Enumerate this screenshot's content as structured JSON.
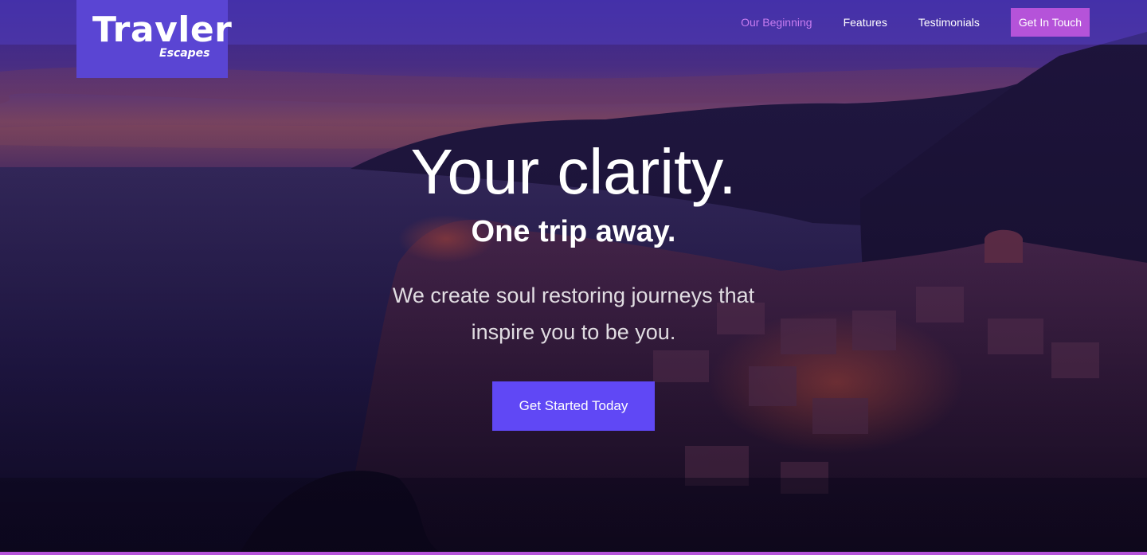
{
  "brand": {
    "name": "Travler",
    "tagline": "Escapes"
  },
  "nav": {
    "items": [
      {
        "label": "Our Beginning",
        "active": true
      },
      {
        "label": "Features",
        "active": false
      },
      {
        "label": "Testimonials",
        "active": false
      }
    ],
    "cta_label": "Get In Touch"
  },
  "hero": {
    "headline": "Your clarity.",
    "subheadline": "One trip away.",
    "description_line1": "We create soul restoring journeys that",
    "description_line2": "inspire you to be you.",
    "cta_label": "Get Started Today"
  },
  "colors": {
    "accent": "#b553d9",
    "button": "#6048f5",
    "logo_bg": "#5a45d3",
    "nav_active": "#c77cf0"
  }
}
